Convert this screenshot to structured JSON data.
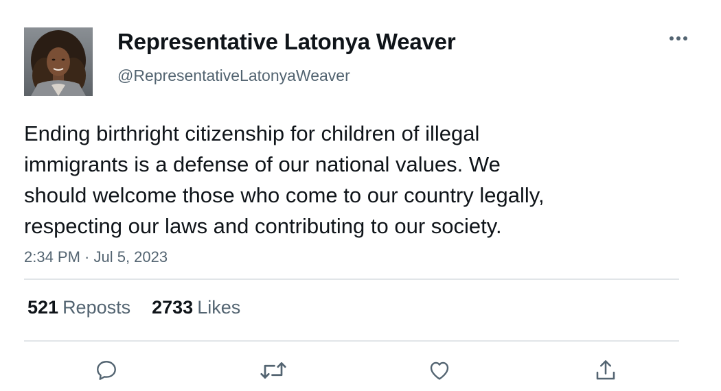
{
  "author": {
    "display_name": "Representative Latonya Weaver",
    "handle": "@RepresentativeLatonyaWeaver"
  },
  "tweet": {
    "lines": [
      "Ending birthright citizenship for children of illegal",
      "immigrants is a defense of our national values. We",
      "should welcome those who come to our country legally,",
      "respecting our laws and contributing to our society."
    ],
    "timestamp": "2:34 PM · Jul 5, 2023"
  },
  "stats": {
    "reposts_count": "521",
    "reposts_label": "Reposts",
    "likes_count": "2733",
    "likes_label": "Likes"
  },
  "icons": {
    "more": "more-horizontal-icon",
    "reply": "reply-bubble-icon",
    "repost": "repost-arrows-icon",
    "like": "heart-icon",
    "share": "share-upload-icon"
  },
  "colors": {
    "text_primary": "#0f1419",
    "text_secondary": "#536471",
    "divider": "#e1e5e8",
    "icon": "#536471"
  }
}
